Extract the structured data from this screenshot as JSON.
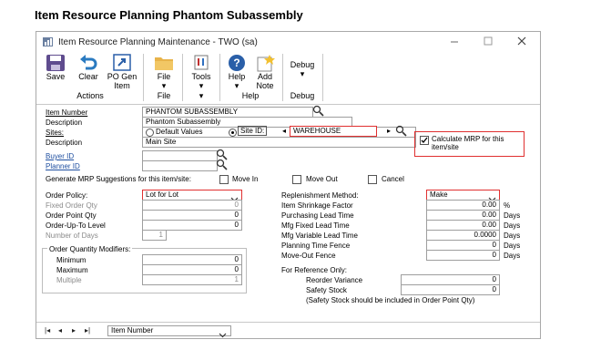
{
  "doc_title": "Item Resource Planning Phantom Subassembly",
  "window": {
    "title": "Item Resource Planning Maintenance  -  TWO (sa)",
    "min_icon": "minimize-icon",
    "max_icon": "maximize-icon",
    "close_icon": "close-icon"
  },
  "ribbon": {
    "save": "Save",
    "clear": "Clear",
    "po_gen_1": "PO Gen",
    "po_gen_2": "Item",
    "file": "File",
    "tools": "Tools",
    "help": "Help",
    "add_note_1": "Add",
    "add_note_2": "Note",
    "debug": "Debug",
    "group_actions": "Actions",
    "group_file": "File",
    "group_tools": "▾",
    "group_help": "Help",
    "group_debug": "Debug",
    "dropdown_arrow": "▾"
  },
  "header": {
    "item_number_label": "Item Number",
    "item_number": "PHANTOM SUBASSEMBLY",
    "description_label": "Description",
    "description": "Phantom Subassembly",
    "sites_label": "Sites:",
    "default_values": "Default Values",
    "site_id": "Site ID:",
    "site_value": "WAREHOUSE",
    "site_description_label": "Description",
    "site_description": "Main Site",
    "calc_mrp": "Calculate MRP for this item/site",
    "buyer_id_label": "Buyer ID",
    "buyer_id": "",
    "planner_id_label": "Planner ID",
    "planner_id": "",
    "generate_label": "Generate MRP Suggestions for this item/site:",
    "move_in": "Move In",
    "move_out": "Move Out",
    "cancel": "Cancel"
  },
  "left": {
    "order_policy_label": "Order Policy:",
    "order_policy": "Lot for Lot",
    "fixed_order_qty_label": "Fixed Order Qty",
    "fixed_order_qty": "0",
    "order_point_qty_label": "Order Point Qty",
    "order_point_qty": "0",
    "order_up_to_label": "Order-Up-To Level",
    "order_up_to": "0",
    "number_of_days_label": "Number of Days",
    "number_of_days": "1",
    "modifiers_title": "Order Quantity Modifiers:",
    "minimum_label": "Minimum",
    "minimum": "0",
    "maximum_label": "Maximum",
    "maximum": "0",
    "multiple_label": "Multiple",
    "multiple": "1"
  },
  "right": {
    "replenishment_label": "Replenishment Method:",
    "replenishment": "Make",
    "shrinkage_label": "Item Shrinkage Factor",
    "shrinkage": "0.00",
    "shrinkage_unit": "%",
    "purch_lead_label": "Purchasing Lead Time",
    "purch_lead": "0.00",
    "purch_lead_unit": "Days",
    "mfg_fixed_label": "Mfg Fixed Lead Time",
    "mfg_fixed": "0.00",
    "mfg_fixed_unit": "Days",
    "mfg_var_label": "Mfg Variable Lead Time",
    "mfg_var": "0.0000",
    "mfg_var_unit": "Days",
    "planning_fence_label": "Planning Time Fence",
    "planning_fence": "0",
    "planning_fence_unit": "Days",
    "move_out_fence_label": "Move-Out Fence",
    "move_out_fence": "0",
    "move_out_fence_unit": "Days",
    "reference_title": "For Reference Only:",
    "reorder_var_label": "Reorder Variance",
    "reorder_var": "0",
    "safety_stock_label": "Safety Stock",
    "safety_stock": "0",
    "safety_note": "(Safety Stock should be included in Order Point Qty)"
  },
  "status": {
    "first": "|◂",
    "prev": "◂",
    "next": "▸",
    "last": "▸|",
    "sort_by": "Item Number"
  }
}
